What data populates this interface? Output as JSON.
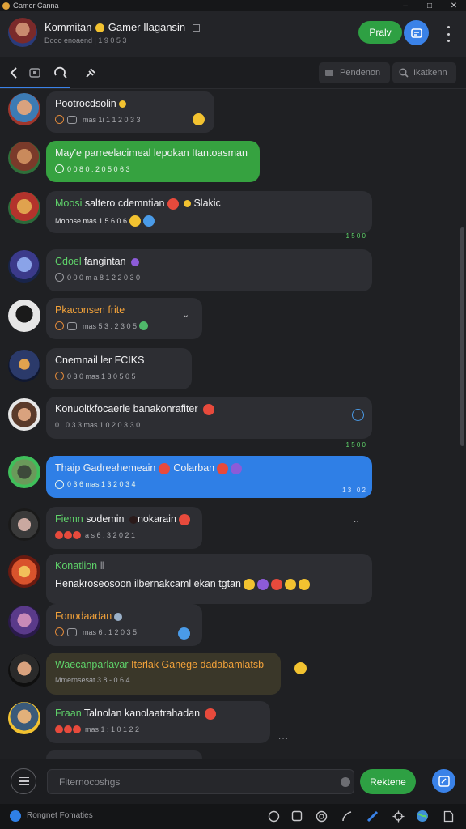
{
  "window": {
    "title": "Gamer Canna",
    "controls": [
      "minimize",
      "maximize",
      "close"
    ]
  },
  "header": {
    "title": "Kommitan",
    "title_suffix": "Gamer Ilagansin",
    "subtitle": "Dooo enoaend | 1 9 0 5 3",
    "primary_button": "Pralv",
    "secondary_button_icon": "grid-icon",
    "menu_icon": "kebab-icon"
  },
  "toolbar": {
    "icons": [
      "back-arrow-icon",
      "window-icon",
      "refresh-icon",
      "pin-icon"
    ],
    "filter_button": "Pendenon",
    "search_button": "Ikatkenn"
  },
  "messages": [
    {
      "text": "Pootrocdsolin",
      "meta": "mas 1i 1 1 2 0 3 3",
      "color": "white",
      "bubble": "dark"
    },
    {
      "text": "May'e parreelacimeal lepokan Itantoasman",
      "meta": "0 0 8 0 : 2 0 5 0 6 3",
      "color": "white",
      "bubble": "green"
    },
    {
      "text_accent": "Moosi",
      "text": "saltero cdemntian",
      "text_tail": "Slakic",
      "meta": "Mobose mas 1 5 6 0 6",
      "color": "green",
      "bubble": "dark",
      "stamp": "1 5 0 0"
    },
    {
      "text_accent": "Cdoel",
      "text": "fangintan",
      "meta": "0 0 0 m a 8 1 2 2 0 3 0",
      "color": "green",
      "bubble": "dark"
    },
    {
      "text": "Pkaconsen frite",
      "meta": "mas 5 3 . 2 3 0 5",
      "color": "orange",
      "bubble": "dark"
    },
    {
      "text": "Cnemnail ler FCIKS",
      "meta": "0 3 0 mas 1 3 0 5 0 5",
      "color": "white",
      "bubble": "dark"
    },
    {
      "text": "Konuoltkfocaerle banakonrafiter",
      "meta": "0 3 3 mas 1 0 2 0 3 3 0",
      "color": "white",
      "bubble": "dark",
      "stamp": "1 5 0 0"
    },
    {
      "text": "Thaip Gadreahemeain",
      "text_tail": "Colarban",
      "meta": "0 3 6 mas 1 3 2 0 3 4",
      "color": "white",
      "bubble": "blue",
      "stamp": "1 3 : 0 2"
    },
    {
      "text_accent": "Fiemn",
      "text": "sodemin",
      "text_tail": "nokarain",
      "meta": "a s 6 . 3 2 0 2 1",
      "color": "green",
      "bubble": "dark"
    },
    {
      "text_accent": "Konatlion",
      "text": "Henakroseosoon ilbernakcaml ekan tgtan",
      "meta": "",
      "color": "green",
      "bubble": "dark"
    },
    {
      "text": "Fonodaadan",
      "meta": "mas 6 : 1 2 0 3 5",
      "color": "orange",
      "bubble": "dark"
    },
    {
      "text_accent": "Waecanparlavar",
      "text": "Iterlak Ganege dadabamlatsb",
      "meta": "Mmernsesat 3 8 - 0 6 4",
      "color": "green",
      "bubble": "olive"
    },
    {
      "text_accent": "Fraan",
      "text": "Talnolan kanolaatrahadan",
      "meta": "mas 1 : 1 0 1 2 2",
      "color": "green",
      "bubble": "dark"
    }
  ],
  "composer": {
    "placeholder": "Fiternocoshgs",
    "send_button": "Rektene",
    "extra_button_icon": "compose-icon"
  },
  "status": {
    "text": "Rongnet Fomaties",
    "icons": [
      "chat-icon",
      "square-icon",
      "copyright-icon",
      "brush-icon",
      "chart-icon",
      "crosshair-icon",
      "globe-icon",
      "document-icon"
    ]
  }
}
